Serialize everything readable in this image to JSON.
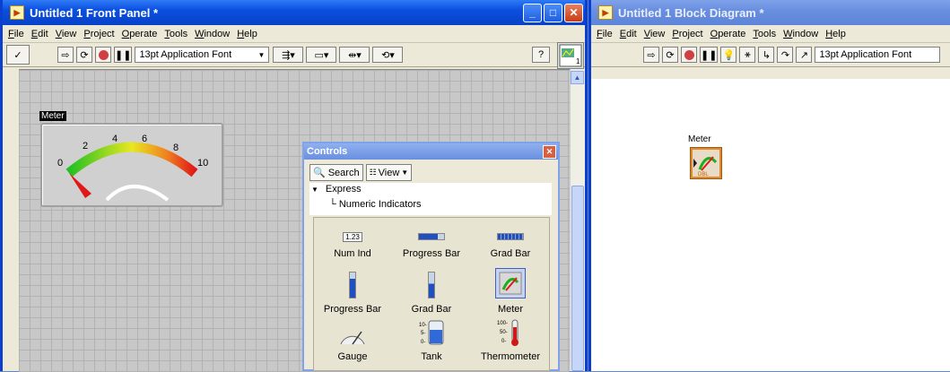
{
  "front_panel": {
    "title": "Untitled 1 Front Panel *",
    "menu": [
      "File",
      "Edit",
      "View",
      "Project",
      "Operate",
      "Tools",
      "Window",
      "Help"
    ],
    "font": "13pt Application Font",
    "meter": {
      "caption": "Meter",
      "scale": [
        "0",
        "2",
        "4",
        "6",
        "8",
        "10"
      ],
      "value": 0
    }
  },
  "block_diagram": {
    "title": "Untitled 1 Block Diagram *",
    "menu": [
      "File",
      "Edit",
      "View",
      "Project",
      "Operate",
      "Tools",
      "Window",
      "Help"
    ],
    "font": "13pt Application Font",
    "terminal_label": "Meter",
    "terminal_type": "DBL"
  },
  "controls_palette": {
    "title": "Controls",
    "search_label": "Search",
    "view_label": "View",
    "tree_root": "Express",
    "tree_child": "Numeric Indicators",
    "items": [
      {
        "label": "Num Ind",
        "icon": "numeric-indicator-icon",
        "glyph": "1.23"
      },
      {
        "label": "Progress Bar",
        "icon": "horizontal-progress-bar-icon"
      },
      {
        "label": "Grad Bar",
        "icon": "horizontal-graduated-bar-icon"
      },
      {
        "label": "Progress Bar",
        "icon": "vertical-progress-bar-icon"
      },
      {
        "label": "Grad Bar",
        "icon": "vertical-graduated-bar-icon"
      },
      {
        "label": "Meter",
        "icon": "meter-icon"
      },
      {
        "label": "Gauge",
        "icon": "gauge-icon"
      },
      {
        "label": "Tank",
        "icon": "tank-icon"
      },
      {
        "label": "Thermometer",
        "icon": "thermometer-icon"
      }
    ]
  },
  "colors": {
    "title_active": "#0a4fe0",
    "title_inactive": "#6a8fe0",
    "grid_bg": "#c8c8c8",
    "meter_green": "#22c022",
    "meter_red": "#e01818",
    "terminal_orange": "#e08a30"
  }
}
